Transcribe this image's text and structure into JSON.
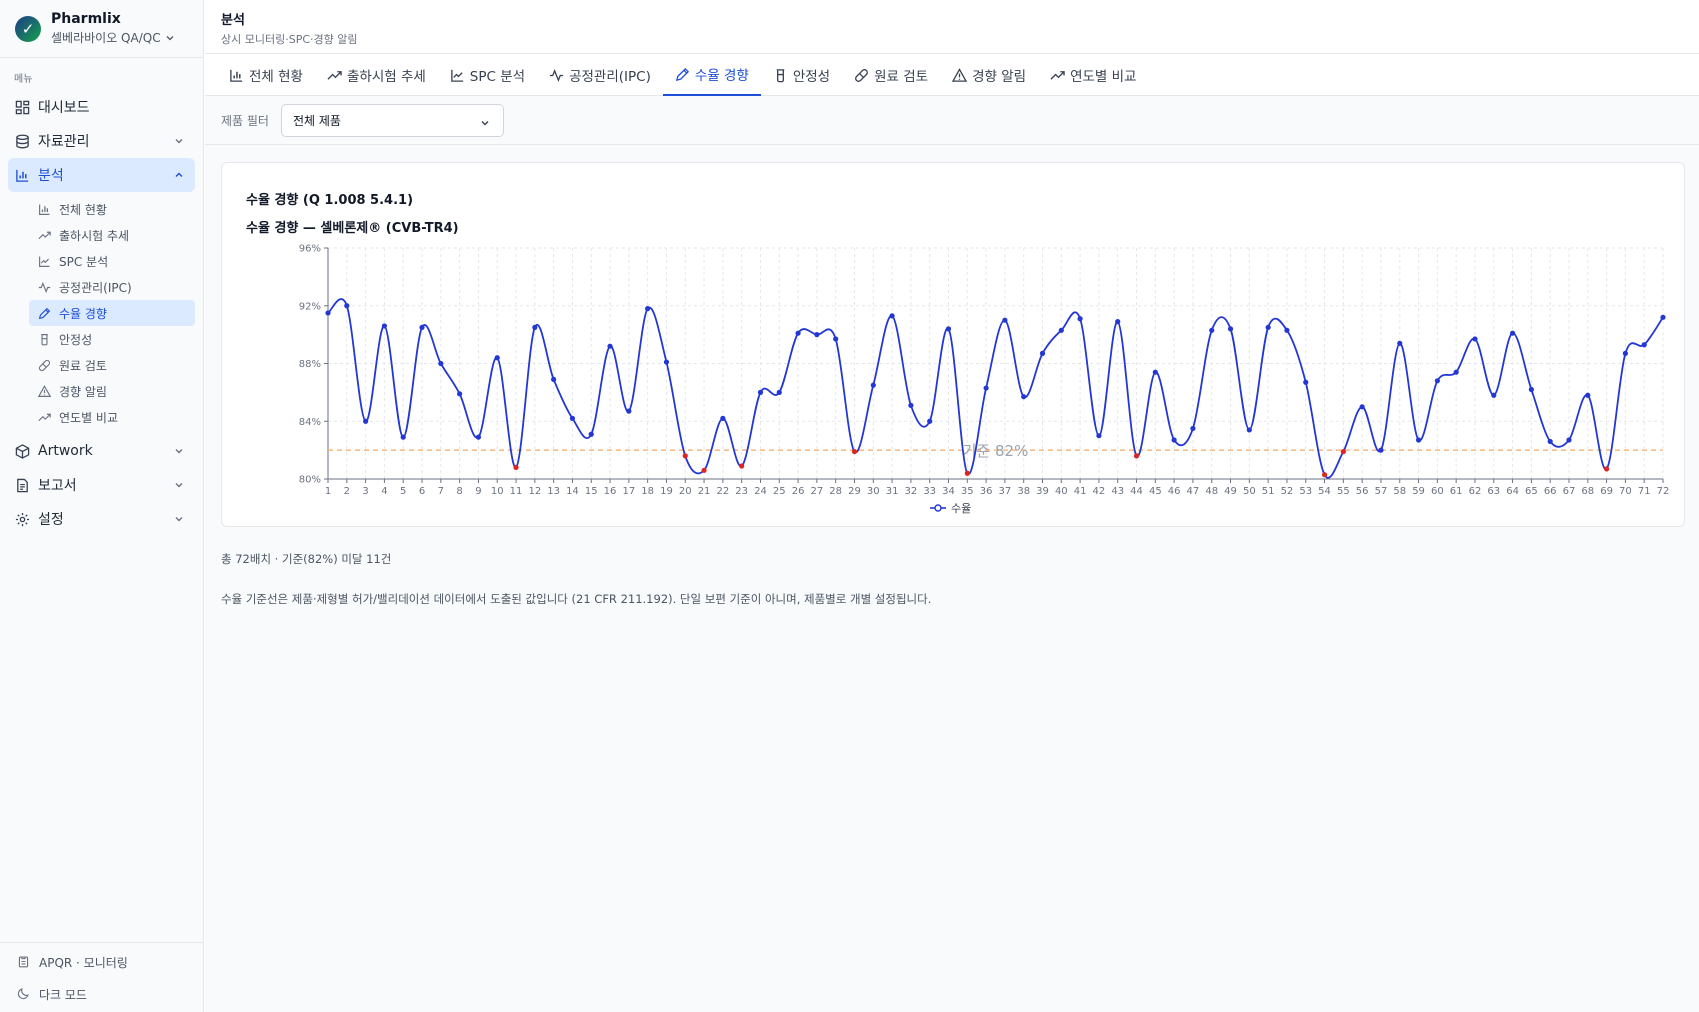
{
  "app": {
    "name": "Pharmlix",
    "org": "셀베라바이오 QA/QC"
  },
  "sidebar": {
    "menu_caption": "메뉴",
    "items": [
      {
        "label": "대시보드",
        "icon": "dashboard-icon"
      },
      {
        "label": "자료관리",
        "icon": "database-icon"
      },
      {
        "label": "분석",
        "icon": "bar-chart-icon"
      }
    ],
    "sub_items": [
      {
        "label": "전체 현황",
        "icon": "bar-chart-icon"
      },
      {
        "label": "출하시험 추세",
        "icon": "trending-up-icon"
      },
      {
        "label": "SPC 분석",
        "icon": "line-chart-icon"
      },
      {
        "label": "공정관리(IPC)",
        "icon": "activity-icon"
      },
      {
        "label": "수율 경향",
        "icon": "pencil-icon"
      },
      {
        "label": "안정성",
        "icon": "beaker-icon"
      },
      {
        "label": "원료 검토",
        "icon": "pill-icon"
      },
      {
        "label": "경향 알림",
        "icon": "alert-triangle-icon"
      },
      {
        "label": "연도별 비교",
        "icon": "trending-up-icon"
      }
    ],
    "items_after": [
      {
        "label": "Artwork",
        "icon": "package-icon"
      },
      {
        "label": "보고서",
        "icon": "report-icon"
      },
      {
        "label": "설정",
        "icon": "gear-icon"
      }
    ],
    "footer": {
      "apqr": "APQR · 모니터링",
      "dark_mode": "다크 모드"
    }
  },
  "header": {
    "title": "분석",
    "subtitle": "상시 모니터링·SPC·경향 알림"
  },
  "tabs": [
    {
      "label": "전체 현황",
      "icon": "bar-chart-icon"
    },
    {
      "label": "출하시험 추세",
      "icon": "trending-up-icon"
    },
    {
      "label": "SPC 분석",
      "icon": "line-chart-icon"
    },
    {
      "label": "공정관리(IPC)",
      "icon": "activity-icon"
    },
    {
      "label": "수율 경향",
      "icon": "pencil-icon",
      "active": true
    },
    {
      "label": "안정성",
      "icon": "beaker-icon"
    },
    {
      "label": "원료 검토",
      "icon": "pill-icon"
    },
    {
      "label": "경향 알림",
      "icon": "alert-triangle-icon"
    },
    {
      "label": "연도별 비교",
      "icon": "trending-up-icon"
    }
  ],
  "filter": {
    "label": "제품 필터",
    "value": "전체 제품"
  },
  "card": {
    "title": "수율 경향 (Q 1.008 5.4.1)",
    "subtitle": "수율 경향 — 셀베론제® (CVB-TR4)"
  },
  "summary": "총 72배치 · 기준(82%) 미달 11건",
  "note": "수율 기준선은 제품·제형별 허가/밸리데이션 데이터에서 도출된 값입니다 (21 CFR 211.192). 단일 보편 기준이 아니며, 제품별로 개별 설정됩니다.",
  "colors": {
    "accent": "#1d4ed8",
    "line": "#2337d4",
    "below": "#dc2626",
    "threshold": "#f5a964"
  },
  "chart_data": {
    "type": "line",
    "x": [
      1,
      2,
      3,
      4,
      5,
      6,
      7,
      8,
      9,
      10,
      11,
      12,
      13,
      14,
      15,
      16,
      17,
      18,
      19,
      20,
      21,
      22,
      23,
      24,
      25,
      26,
      27,
      28,
      29,
      30,
      31,
      32,
      33,
      34,
      35,
      36,
      37,
      38,
      39,
      40,
      41,
      42,
      43,
      44,
      45,
      46,
      47,
      48,
      49,
      50,
      51,
      52,
      53,
      54,
      55,
      56,
      57,
      58,
      59,
      60,
      61,
      62,
      63,
      64,
      65,
      66,
      67,
      68,
      69,
      70,
      71,
      72
    ],
    "series": [
      {
        "name": "수율",
        "values": [
          91.5,
          92.0,
          84.0,
          90.6,
          82.9,
          90.5,
          88.0,
          85.9,
          82.9,
          88.4,
          80.8,
          90.5,
          86.9,
          84.2,
          83.1,
          89.2,
          84.7,
          91.8,
          88.1,
          81.6,
          80.6,
          84.2,
          80.9,
          86.0,
          86.0,
          90.1,
          90.0,
          89.7,
          81.9,
          86.5,
          91.3,
          85.1,
          84.0,
          90.4,
          80.4,
          86.3,
          91.0,
          85.7,
          88.7,
          90.3,
          91.1,
          83.0,
          90.9,
          81.6,
          87.4,
          82.7,
          83.5,
          90.3,
          90.4,
          83.4,
          90.5,
          90.3,
          86.7,
          80.3,
          81.9,
          85.0,
          82.0,
          89.4,
          82.7,
          86.8,
          87.4,
          89.7,
          85.8,
          90.1,
          86.2,
          82.6,
          82.7,
          85.8,
          80.7,
          88.7,
          89.3,
          91.2
        ]
      }
    ],
    "threshold": {
      "value": 82,
      "label": "기준 82%"
    },
    "ylim": [
      80,
      96
    ],
    "yticks": [
      80,
      84,
      88,
      92,
      96
    ],
    "ytick_labels": [
      "80%",
      "84%",
      "88%",
      "92%",
      "96%"
    ],
    "legend": {
      "label": "수율",
      "position": "bottom"
    },
    "grid": true
  }
}
